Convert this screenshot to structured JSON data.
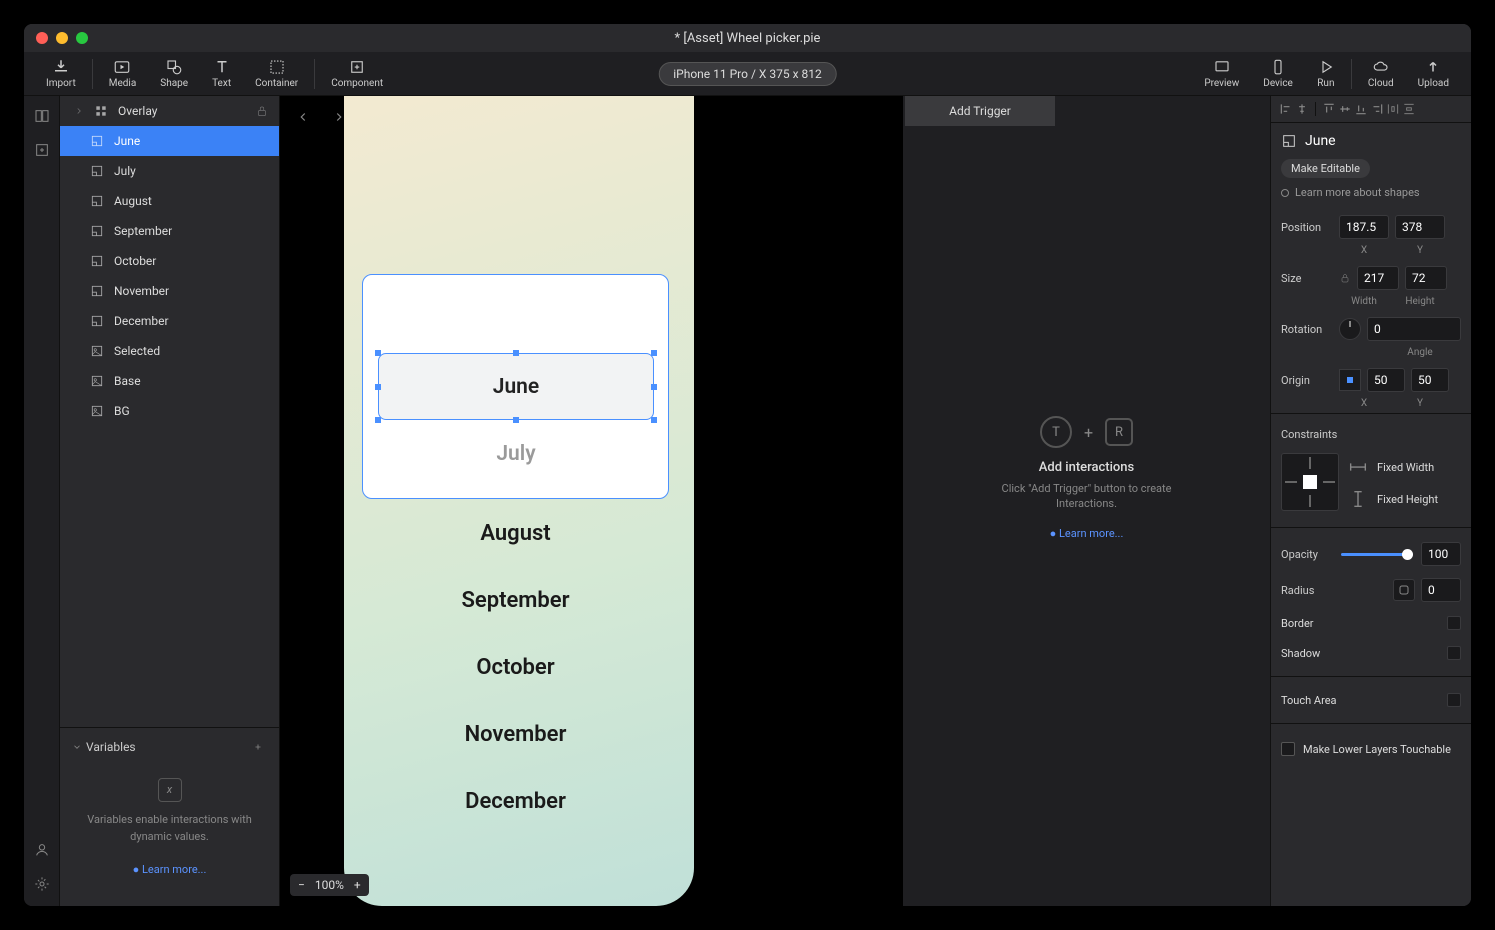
{
  "titlebar": {
    "title": "* [Asset] Wheel picker.pie"
  },
  "toolbar": {
    "import": "Import",
    "media": "Media",
    "shape": "Shape",
    "text": "Text",
    "container": "Container",
    "component": "Component",
    "device_pill": "iPhone 11 Pro / X  375 x 812",
    "preview": "Preview",
    "device": "Device",
    "run": "Run",
    "cloud": "Cloud",
    "upload": "Upload"
  },
  "layers": {
    "items": [
      {
        "label": "Overlay",
        "type": "group"
      },
      {
        "label": "June",
        "type": "shape",
        "selected": true
      },
      {
        "label": "July",
        "type": "shape"
      },
      {
        "label": "August",
        "type": "shape"
      },
      {
        "label": "September",
        "type": "shape"
      },
      {
        "label": "October",
        "type": "shape"
      },
      {
        "label": "November",
        "type": "shape"
      },
      {
        "label": "December",
        "type": "shape"
      },
      {
        "label": "Selected",
        "type": "img"
      },
      {
        "label": "Base",
        "type": "img"
      },
      {
        "label": "BG",
        "type": "img"
      }
    ]
  },
  "variables": {
    "header": "Variables",
    "desc": "Variables enable interactions with dynamic values.",
    "learn": "Learn more..."
  },
  "canvas": {
    "june": "June",
    "july": "July",
    "months": [
      "August",
      "September",
      "October",
      "November",
      "December"
    ],
    "zoom": "100%"
  },
  "trigger": {
    "add": "Add Trigger",
    "t": "T",
    "r": "R",
    "plus": "+",
    "title": "Add interactions",
    "desc": "Click \"Add Trigger\" button to create Interactions.",
    "learn": "Learn more..."
  },
  "inspector": {
    "title": "June",
    "make_editable": "Make Editable",
    "learn_shapes": "Learn more about shapes",
    "position_label": "Position",
    "pos_x": "187.5",
    "pos_y": "378",
    "x": "X",
    "y": "Y",
    "size_label": "Size",
    "w": "217",
    "h": "72",
    "width": "Width",
    "height": "Height",
    "rotation_label": "Rotation",
    "angle": "0",
    "angle_label": "Angle",
    "origin_label": "Origin",
    "ox": "50",
    "oy": "50",
    "constraints_label": "Constraints",
    "fixed_width": "Fixed Width",
    "fixed_height": "Fixed Height",
    "opacity_label": "Opacity",
    "opacity": "100",
    "radius_label": "Radius",
    "radius": "0",
    "border_label": "Border",
    "shadow_label": "Shadow",
    "touch_label": "Touch Area",
    "lower_layers": "Make Lower Layers Touchable"
  }
}
